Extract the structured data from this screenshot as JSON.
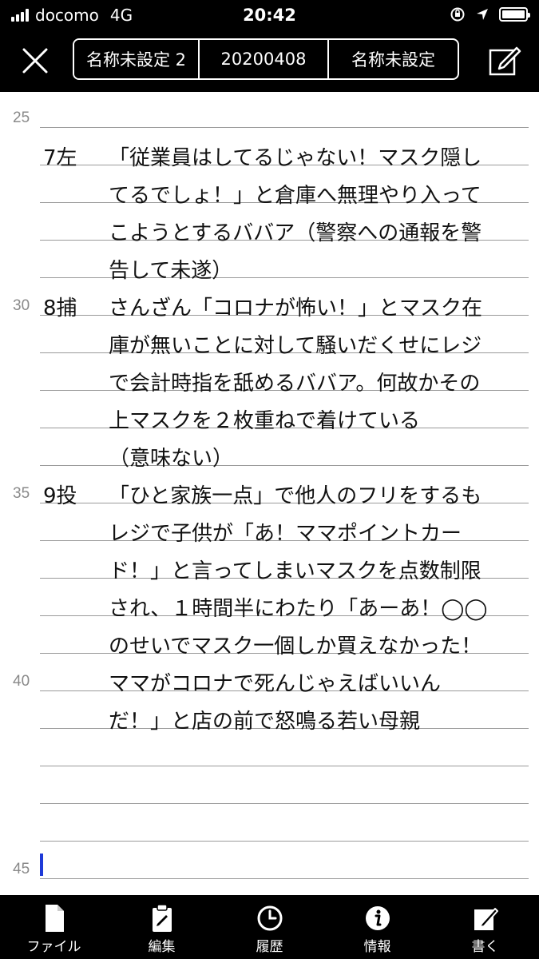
{
  "status": {
    "carrier": "docomo",
    "network": "4G",
    "time": "20:42"
  },
  "nav": {
    "segments": [
      "名称未設定 2",
      "20200408",
      "名称未設定"
    ],
    "active_segment": 0,
    "close_icon": "close-icon",
    "edit_icon": "compose-icon"
  },
  "editor": {
    "line_numbers": [
      "25",
      "30",
      "35",
      "40",
      "45"
    ],
    "labels": [
      "7左",
      "8捕",
      "9投"
    ],
    "lines": [
      "「従業員はしてるじゃない！マスク隠し",
      "てるでしょ！」と倉庫へ無理やり入って",
      "こようとするババア（警察への通報を警",
      "告して未遂）",
      "さんざん「コロナが怖い！」とマスク在",
      "庫が無いことに対して騒いだくせにレジ",
      "で会計時指を舐めるババア。何故かその",
      "上マスクを２枚重ねで着けている",
      "（意味ない）",
      "「ひと家族一点」で他人のフリをするも",
      "レジで子供が「あ！ママポイントカー",
      "ド！」と言ってしまいマスクを点数制限",
      "され、１時間半にわたり「あーあ！◯◯",
      "のせいでマスク一個しか買えなかった！",
      "ママがコロナで死んじゃえばいいん",
      "だ！」と店の前で怒鳴る若い母親"
    ]
  },
  "tabs": [
    {
      "label": "ファイル",
      "icon": "file-icon"
    },
    {
      "label": "編集",
      "icon": "clipboard-icon"
    },
    {
      "label": "履歴",
      "icon": "clock-icon"
    },
    {
      "label": "情報",
      "icon": "info-icon"
    },
    {
      "label": "書く",
      "icon": "compose-icon"
    }
  ],
  "colors": {
    "bar_bg": "#000000",
    "rule": "#9a9a9a",
    "cursor": "#1e3ad8",
    "line_number": "#8a8a8a"
  }
}
